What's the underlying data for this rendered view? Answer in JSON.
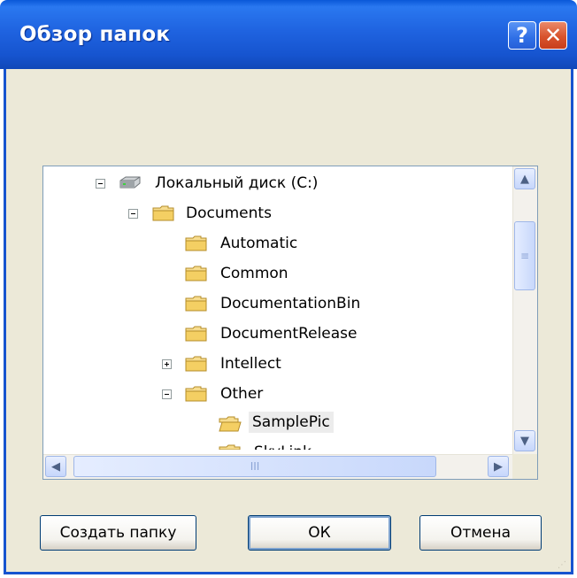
{
  "window": {
    "title": "Обзор папок",
    "help_symbol": "?",
    "close_symbol": "✕"
  },
  "tree": {
    "items": [
      {
        "label": "Локальный диск (C:)",
        "expander": "minus",
        "icon": "drive-icon"
      },
      {
        "label": "Documents",
        "expander": "minus",
        "icon": "folder-icon"
      },
      {
        "label": "Automatic",
        "expander": "",
        "icon": "folder-icon"
      },
      {
        "label": "Common",
        "expander": "",
        "icon": "folder-icon"
      },
      {
        "label": "DocumentationBin",
        "expander": "",
        "icon": "folder-icon"
      },
      {
        "label": "DocumentRelease",
        "expander": "",
        "icon": "folder-icon"
      },
      {
        "label": "Intellect",
        "expander": "plus",
        "icon": "folder-icon"
      },
      {
        "label": "Other",
        "expander": "minus",
        "icon": "folder-icon"
      },
      {
        "label": "SamplePic",
        "expander": "",
        "icon": "folder-open-icon",
        "selected": true
      },
      {
        "label": "SkyLink",
        "expander": "",
        "icon": "folder-icon"
      }
    ]
  },
  "scrollbar": {
    "up": "▲",
    "down": "▼",
    "left": "◀",
    "right": "▶",
    "grip": "≡",
    "hgrip": "III"
  },
  "buttons": {
    "new_folder": "Создать папку",
    "ok": "ОК",
    "cancel": "Отмена"
  },
  "colors": {
    "titlebar": "#1654cf",
    "dialog_bg": "#ece9d8",
    "folder": "#f5d57a"
  }
}
